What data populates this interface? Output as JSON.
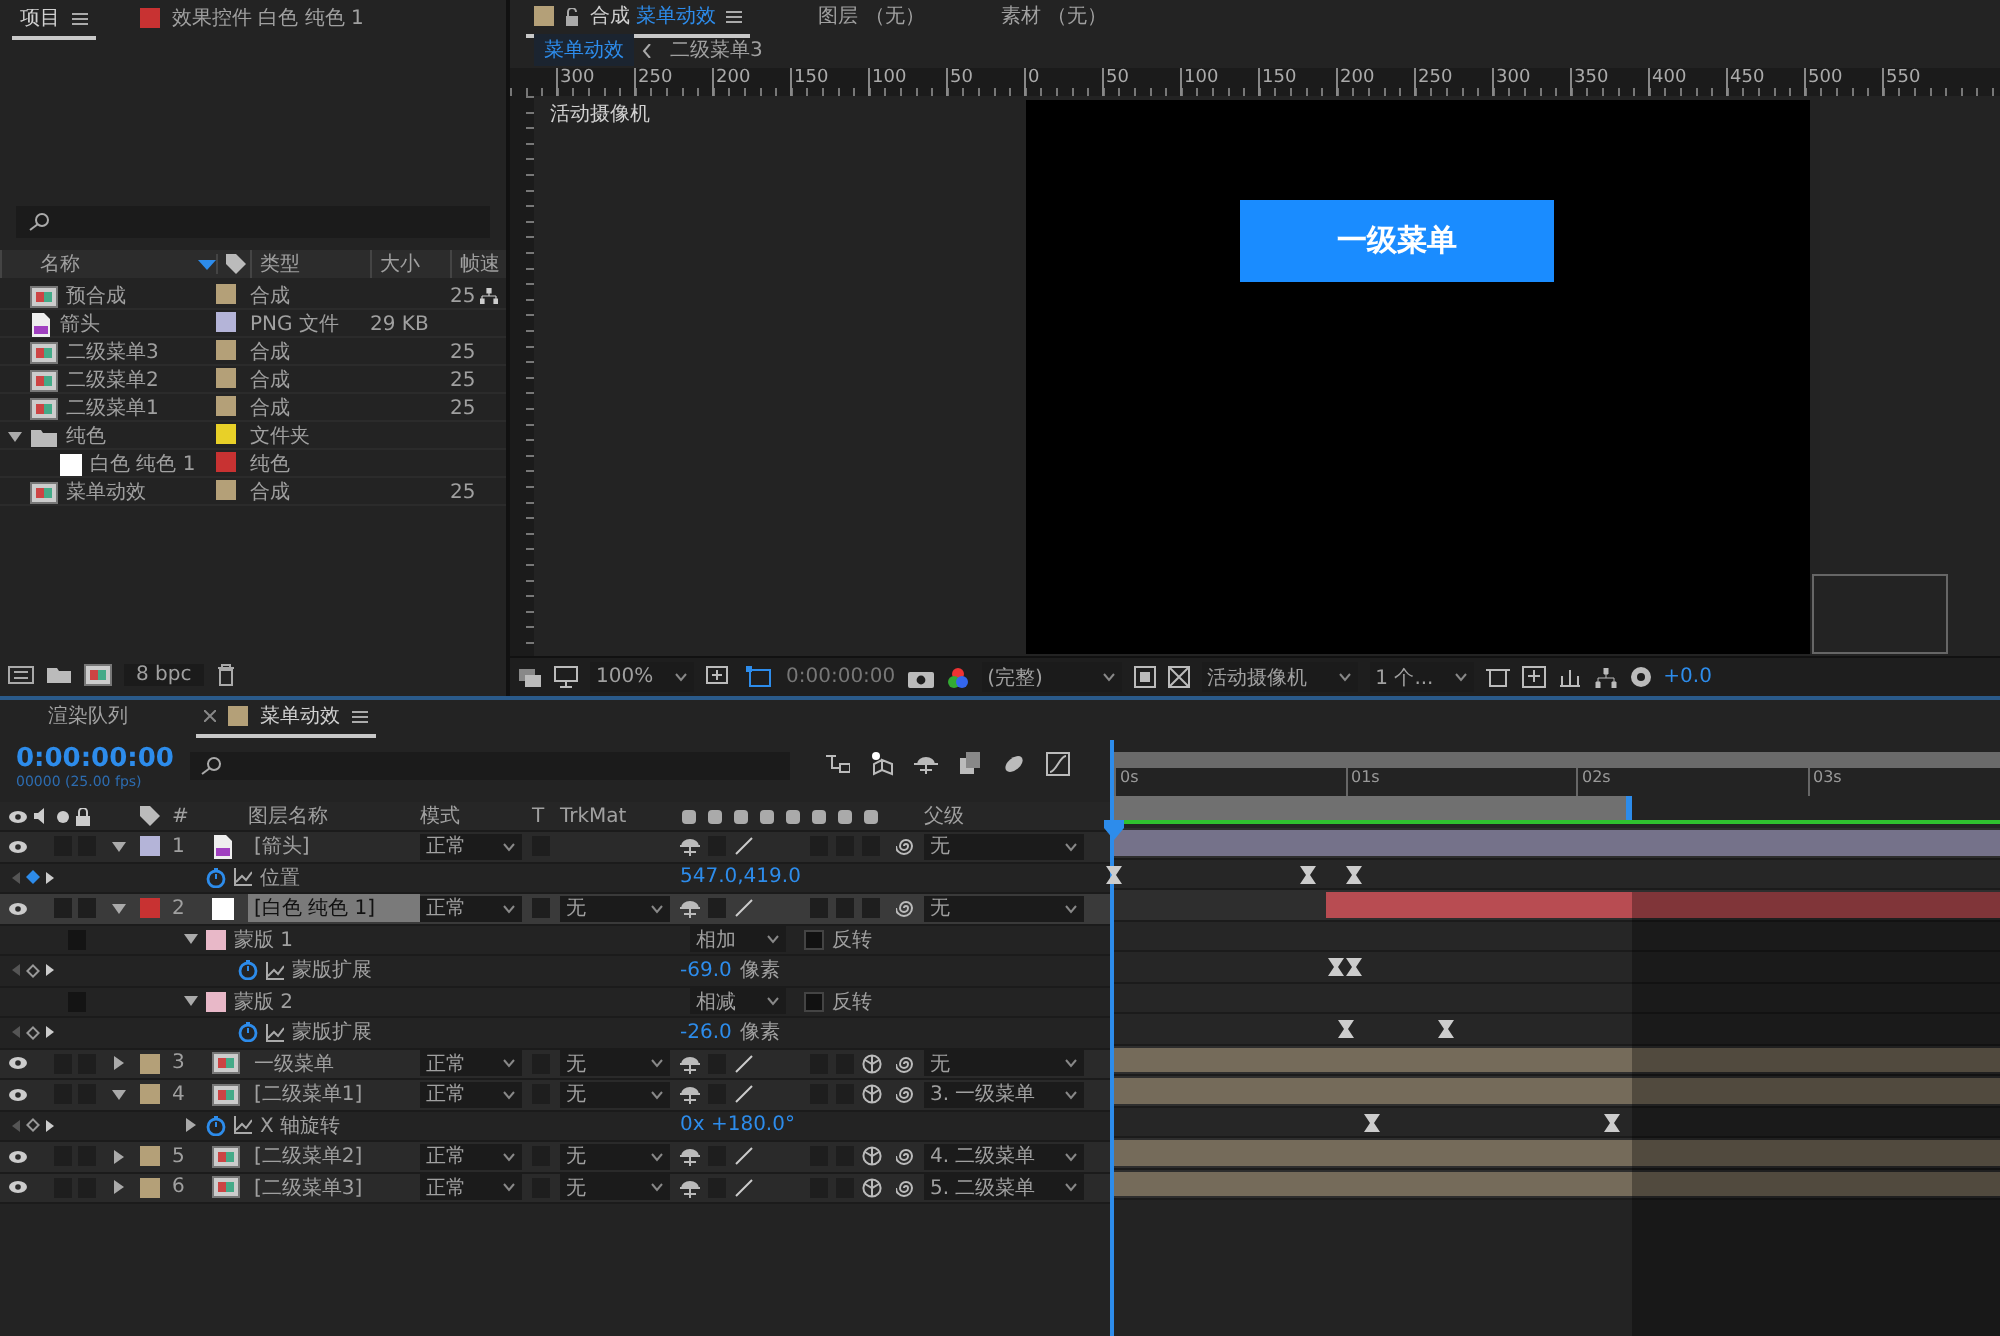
{
  "project_panel": {
    "tabs": [
      {
        "label": "项目",
        "selected": true
      },
      {
        "label": "效果控件 白色 纯色 1",
        "selected": false,
        "color": "#c83232"
      }
    ],
    "columns": [
      "名称",
      "类型",
      "大小",
      "帧速"
    ],
    "items": [
      {
        "kind": "comp",
        "name": "预合成",
        "type": "合成",
        "fps": "25",
        "color": "#b4a078",
        "flowchart": true
      },
      {
        "kind": "png",
        "name": "箭头",
        "type": "PNG 文件",
        "size": "29 KB",
        "color": "#b4b4d8",
        "flowchart": false
      },
      {
        "kind": "comp",
        "name": "二级菜单3",
        "type": "合成",
        "fps": "25",
        "color": "#b4a078",
        "flowchart": false
      },
      {
        "kind": "comp",
        "name": "二级菜单2",
        "type": "合成",
        "fps": "25",
        "color": "#b4a078",
        "flowchart": false
      },
      {
        "kind": "comp",
        "name": "二级菜单1",
        "type": "合成",
        "fps": "25",
        "color": "#b4a078",
        "flowchart": false
      },
      {
        "kind": "folder",
        "name": "纯色",
        "type": "文件夹",
        "color": "#e8d028",
        "flowchart": false,
        "expanded": true,
        "children": [
          {
            "kind": "solid",
            "name": "白色 纯色 1",
            "type": "纯色",
            "color": "#c83232",
            "flowchart": false
          }
        ]
      },
      {
        "kind": "comp",
        "name": "菜单动效",
        "type": "合成",
        "fps": "25",
        "color": "#b4a078",
        "flowchart": false
      }
    ],
    "bit_depth": "8 bpc"
  },
  "composition_panel": {
    "tabs": [
      {
        "prefix": "合成",
        "label": "菜单动效",
        "selected": true,
        "color": "#b4a078"
      },
      {
        "label": "图层 （无）",
        "selected": false
      },
      {
        "label": "素材 （无）",
        "selected": false
      }
    ],
    "breadcrumbs": [
      {
        "label": "菜单动效",
        "selected": true
      },
      {
        "label": "二级菜单3",
        "selected": false
      }
    ],
    "ruler": [
      "300",
      "250",
      "200",
      "150",
      "100",
      "50",
      "0",
      "50",
      "100",
      "150",
      "200",
      "250",
      "300",
      "350",
      "400",
      "450",
      "500",
      "550"
    ],
    "camera_label": "活动摄像机",
    "canvas_button": "一级菜单",
    "toolbar": {
      "zoom": "100%",
      "time": "0:00:00:00",
      "resolution": "(完整)",
      "camera": "活动摄像机",
      "views": "1 个...",
      "exposure": "+0.0"
    }
  },
  "timeline": {
    "tabs": [
      {
        "label": "渲染队列",
        "selected": false
      },
      {
        "label": "菜单动效",
        "selected": true,
        "color": "#b4a078"
      }
    ],
    "current_time": "0:00:00:00",
    "frame_info": "00000 (25.00 fps)",
    "columns": [
      "#",
      "图层名称",
      "模式",
      "T",
      "TrkMat",
      "父级"
    ],
    "time_ticks": [
      "0s",
      "01s",
      "02s",
      "03s"
    ],
    "work_area": {
      "level": 0.56
    },
    "layers": [
      {
        "number": "1",
        "name": "[箭头]",
        "kind": "png",
        "color": "#b4b4d8",
        "expanded": true,
        "selected": false,
        "mode": "正常",
        "parent": "无",
        "three_d": false,
        "level": 1,
        "children": [
          {
            "kind": "property",
            "name": "位置",
            "value": "547.0,419.0",
            "at_keyframe": true,
            "keyframes": [
              {
                "level": 0
              },
              {
                "level": 0.21
              },
              {
                "level": 0.26
              }
            ]
          }
        ]
      },
      {
        "number": "2",
        "name": "[白色 纯色 1]",
        "kind": "solid",
        "color": "#c83232",
        "expanded": true,
        "selected": true,
        "mode": "正常",
        "trkmat": "无",
        "parent": "无",
        "three_d": false,
        "level": 0.77,
        "children": [
          {
            "kind": "mask",
            "name": "蒙版 1",
            "color": "#e8b8c8",
            "expanded": true,
            "mode": "相加",
            "invert_label": "反转",
            "inverted": false,
            "children": [
              {
                "kind": "property",
                "name": "蒙版扩展",
                "value": "-69.0",
                "unit": "像素",
                "at_keyframe": false,
                "keyframes": [
                  {
                    "level": 0.24
                  },
                  {
                    "level": 0.26
                  }
                ]
              }
            ]
          },
          {
            "kind": "mask",
            "name": "蒙版 2",
            "color": "#e8b8c8",
            "expanded": true,
            "mode": "相减",
            "invert_label": "反转",
            "inverted": false,
            "children": [
              {
                "kind": "property",
                "name": "蒙版扩展",
                "value": "-26.0",
                "unit": "像素",
                "at_keyframe": false,
                "keyframes": [
                  {
                    "level": 0.25
                  },
                  {
                    "level": 0.36
                  }
                ]
              }
            ]
          }
        ]
      },
      {
        "number": "3",
        "name": "一级菜单",
        "kind": "comp",
        "color": "#b4a078",
        "expanded": false,
        "selected": false,
        "mode": "正常",
        "trkmat": "无",
        "parent": "无",
        "three_d": true,
        "level": 1
      },
      {
        "number": "4",
        "name": "[二级菜单1]",
        "kind": "comp",
        "color": "#b4a078",
        "expanded": true,
        "selected": false,
        "mode": "正常",
        "trkmat": "无",
        "parent": "3. 一级菜单",
        "three_d": true,
        "level": 1,
        "children": [
          {
            "kind": "property",
            "name": "X 轴旋转",
            "value": "0x +180.0°",
            "expanded": false,
            "at_keyframe": false,
            "keyframes": [
              {
                "level": 0.28
              },
              {
                "level": 0.54
              }
            ]
          }
        ]
      },
      {
        "number": "5",
        "name": "[二级菜单2]",
        "kind": "comp",
        "color": "#b4a078",
        "expanded": false,
        "selected": false,
        "mode": "正常",
        "trkmat": "无",
        "parent": "4. 二级菜单",
        "three_d": true,
        "level": 1
      },
      {
        "number": "6",
        "name": "[二级菜单3]",
        "kind": "comp",
        "color": "#b4a078",
        "expanded": false,
        "selected": false,
        "mode": "正常",
        "trkmat": "无",
        "parent": "5. 二级菜单",
        "three_d": true,
        "level": 1
      }
    ]
  }
}
